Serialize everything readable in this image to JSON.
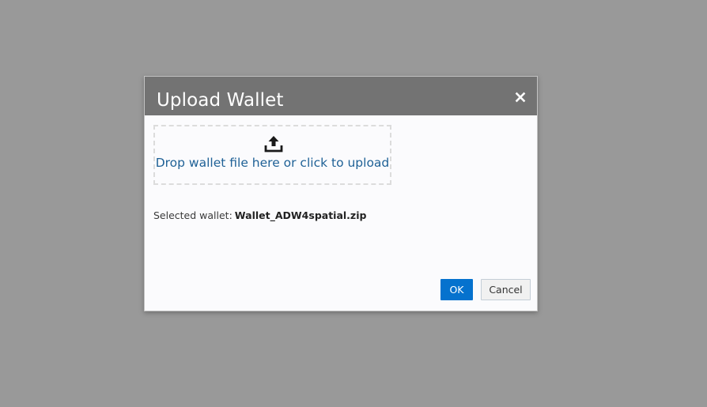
{
  "dialog": {
    "title": "Upload Wallet",
    "close_icon": "close-icon",
    "dropzone": {
      "icon": "upload-icon",
      "text": "Drop wallet file here or click to upload"
    },
    "selected_label": "Selected wallet:",
    "selected_value": "Wallet_ADW4spatial.zip",
    "ok_label": "OK",
    "cancel_label": "Cancel"
  },
  "colors": {
    "backdrop": "#999999",
    "header": "#737373",
    "dialog_bg": "#fbfbfd",
    "link_text": "#1f6196",
    "primary": "#0572ce",
    "secondary_bg": "#f1f1f1"
  }
}
